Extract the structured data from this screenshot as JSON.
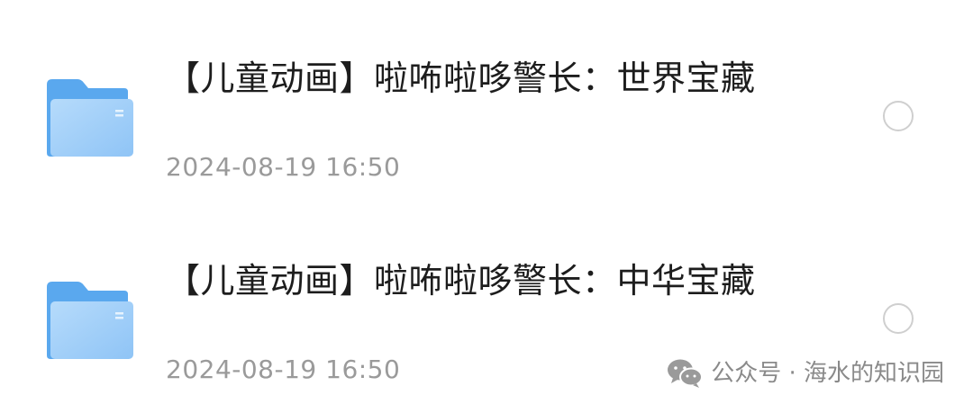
{
  "files": [
    {
      "title": "【儿童动画】啦咘啦哆警长：世界宝藏",
      "date": "2024-08-19 16:50",
      "icon": "folder-icon"
    },
    {
      "title": "【儿童动画】啦咘啦哆警长：中华宝藏",
      "date": "2024-08-19 16:50",
      "icon": "folder-icon"
    }
  ],
  "watermark": {
    "text": "公众号 · 海水的知识园",
    "icon": "wechat-icon"
  },
  "colors": {
    "folder_back": "#5aa8ee",
    "folder_front": "#a9d3fa",
    "title": "#1d1d1d",
    "date": "#9a9a9a",
    "radio_border": "#cfcfcf"
  }
}
